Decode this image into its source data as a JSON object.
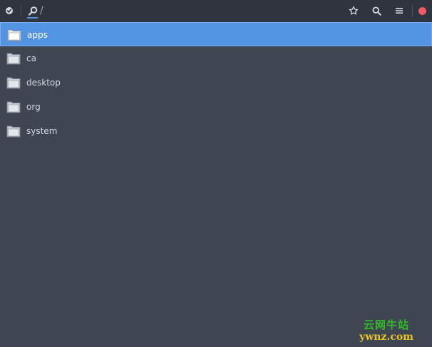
{
  "header": {
    "path_separator": "/",
    "icons": {
      "app": "app-menu-icon",
      "home": "home-search-icon",
      "bookmark": "star-icon",
      "search": "search-icon",
      "menu": "hamburger-menu-icon",
      "close": "close-icon"
    },
    "close_color": "#f05a66",
    "accent": "#5294e2"
  },
  "files": [
    {
      "name": "apps",
      "selected": true
    },
    {
      "name": "ca",
      "selected": false
    },
    {
      "name": "desktop",
      "selected": false
    },
    {
      "name": "org",
      "selected": false
    },
    {
      "name": "system",
      "selected": false
    }
  ],
  "watermark": {
    "site_cn": "云网牛站",
    "site_url": "ywnz.com"
  }
}
